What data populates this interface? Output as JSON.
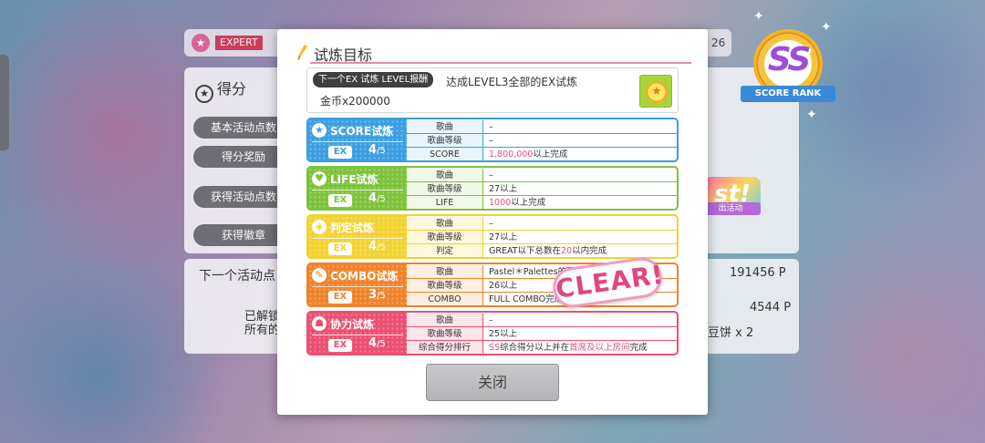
{
  "background": {
    "difficulty": "EXPERT",
    "header_number": "26",
    "score_title": "得分",
    "buttons": [
      "基本活动点数",
      "得分奖励"
    ],
    "rows": [
      "获得活动点数",
      "获得徽章"
    ],
    "next_points_label": "下一个活动点",
    "next_points_value": "191456 P",
    "unlocked_label_1": "已解锁",
    "unlocked_label_2": "所有的",
    "points_2": "4544 P",
    "item_reward": "豆饼 x 2",
    "event_badge_text": "st!",
    "event_label": "出活动"
  },
  "score_rank": {
    "rank": "SS",
    "label": "SCORE RANK"
  },
  "modal": {
    "title": "试炼目标",
    "reward": {
      "tag": "下一个EX 试炼 LEVEL报酬",
      "description": "达成LEVEL3全部的EX试炼",
      "amount": "金币x200000",
      "icon": "coin-icon"
    },
    "close_label": "关闭"
  },
  "trials": [
    {
      "name": "SCORE试炼",
      "icon": "star-icon",
      "ex": "EX",
      "progress": "4",
      "total": "/5",
      "color": "#3a9ee0",
      "light": "#eaf4fc",
      "rows": [
        {
          "k": "歌曲",
          "v": "–"
        },
        {
          "k": "歌曲等级",
          "v": "–"
        },
        {
          "k": "SCORE",
          "v": "1,800,000以上完成"
        }
      ]
    },
    {
      "name": "LIFE试炼",
      "icon": "heart-icon",
      "ex": "EX",
      "progress": "4",
      "total": "/5",
      "color": "#7cc23a",
      "light": "#f0f8e6",
      "rows": [
        {
          "k": "歌曲",
          "v": "–"
        },
        {
          "k": "歌曲等级",
          "v": "27以上"
        },
        {
          "k": "LIFE",
          "v": "1000以上完成"
        }
      ]
    },
    {
      "name": "判定试炼",
      "icon": "target-icon",
      "ex": "EX",
      "progress": "4",
      "total": "/5",
      "color": "#f2d230",
      "light": "#fdf8dc",
      "rows": [
        {
          "k": "歌曲",
          "v": "–"
        },
        {
          "k": "歌曲等级",
          "v": "27以上"
        },
        {
          "k": "判定",
          "v": "GREAT以下总数在20以内完成"
        }
      ]
    },
    {
      "name": "COMBO试炼",
      "icon": "brush-icon",
      "ex": "EX",
      "progress": "3",
      "total": "/5",
      "color": "#f0822a",
      "light": "#fdeee0",
      "rows": [
        {
          "k": "歌曲",
          "v": "Pastel＊Palettes的歌曲"
        },
        {
          "k": "歌曲等级",
          "v": "26以上"
        },
        {
          "k": "COMBO",
          "v": "FULL COMBO完成"
        }
      ]
    },
    {
      "name": "协力试炼",
      "icon": "people-icon",
      "ex": "EX",
      "progress": "4",
      "total": "/5",
      "color": "#ec4f6f",
      "light": "#fde6ea",
      "rows": [
        {
          "k": "歌曲",
          "v": "–"
        },
        {
          "k": "歌曲等级",
          "v": "25以上"
        },
        {
          "k": "综合得分排行",
          "v": "SS综合得分以上并在首席及以上房间完成"
        }
      ]
    }
  ],
  "clear_stamp": "CLEAR!"
}
